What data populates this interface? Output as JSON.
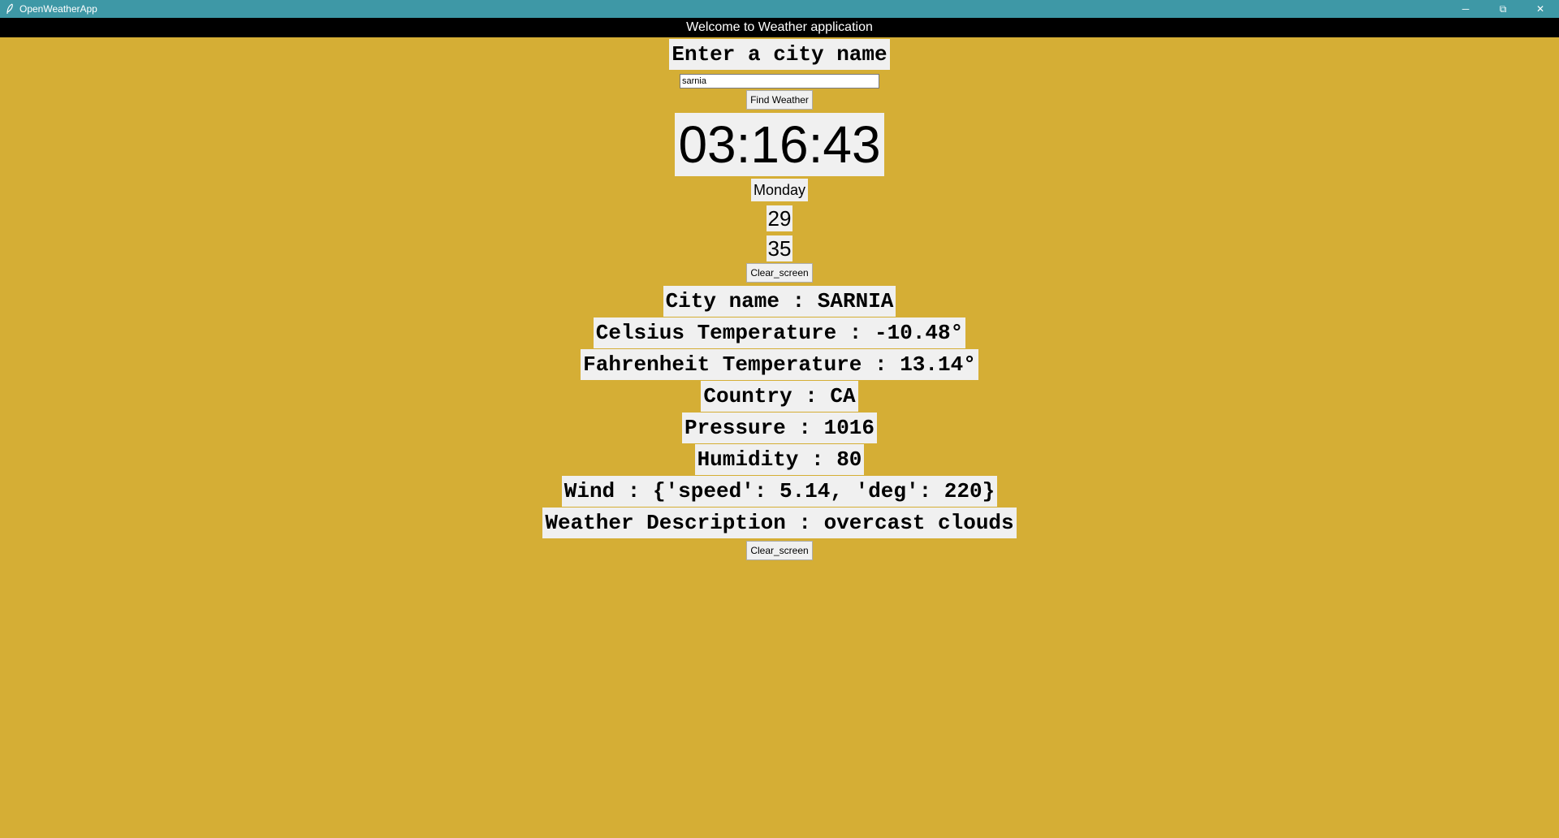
{
  "window": {
    "title": "OpenWeatherApp",
    "controls": {
      "minimize": "─",
      "restore": "⧉",
      "close": "✕"
    }
  },
  "banner": "Welcome to Weather application",
  "search": {
    "prompt": "Enter a city name",
    "value": "sarnia",
    "button_label": "Find Weather"
  },
  "clock": {
    "time": "03:16:43",
    "day": "Monday",
    "num1": "29",
    "num2": "35"
  },
  "clear_button_top": "Clear_screen",
  "results": {
    "city": "City name : SARNIA",
    "celsius": "Celsius Temperature : -10.48°",
    "fahrenheit": "Fahrenheit Temperature : 13.14°",
    "country": "Country : CA",
    "pressure": "Pressure : 1016",
    "humidity": "Humidity : 80",
    "wind": "Wind : {'speed': 5.14, 'deg': 220}",
    "description": "Weather Description : overcast clouds"
  },
  "clear_button_bottom": "Clear_screen",
  "colors": {
    "background": "#d5ae35",
    "titlebar": "#3e98a6",
    "banner": "#000000",
    "label_bg": "#f0f0f0"
  },
  "icons": {
    "app": "feather-icon"
  }
}
